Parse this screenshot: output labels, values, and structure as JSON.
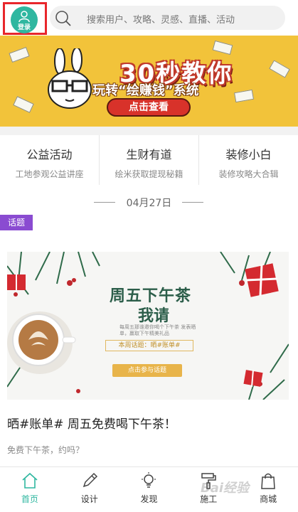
{
  "header": {
    "login_label": "登录",
    "search_placeholder": "搜索用户、攻略、灵感、直播、活动"
  },
  "banner": {
    "title": "30秒教你",
    "subtitle": "玩转“绘赚钱”系统",
    "button_label": "点击查看"
  },
  "categories": [
    {
      "title": "公益活动",
      "subtitle": "工地参观公益讲座"
    },
    {
      "title": "生财有道",
      "subtitle": "绘米获取提现秘籍"
    },
    {
      "title": "装修小白",
      "subtitle": "装修攻略大合辑"
    }
  ],
  "date": "04月27日",
  "article": {
    "tag": "话题",
    "image": {
      "title_line1": "周五下午茶",
      "title_line2": "我请",
      "small_text": "每周五那谁邀你喝个下午茶 发表晒单，赢取下午精美礼品",
      "week_topic": "本周话题：晒#账单#",
      "button_label": "点击参与话题"
    },
    "headline": "晒#账单# 周五免费喝下午茶！",
    "description": "免费下午茶，约吗？"
  },
  "tabbar": [
    {
      "label": "首页",
      "icon": "home-icon",
      "active": true
    },
    {
      "label": "设计",
      "icon": "pencil-icon",
      "active": false
    },
    {
      "label": "发现",
      "icon": "lightbulb-icon",
      "active": false
    },
    {
      "label": "施工",
      "icon": "roller-icon",
      "active": false
    },
    {
      "label": "商城",
      "icon": "shopping-bag-icon",
      "active": false
    }
  ],
  "colors": {
    "accent": "#2fb7a0",
    "banner_bg": "#f2c33a",
    "tag_bg": "#8a4bd1",
    "highlight_box": "#e8262b"
  },
  "watermark": "Bai经验"
}
